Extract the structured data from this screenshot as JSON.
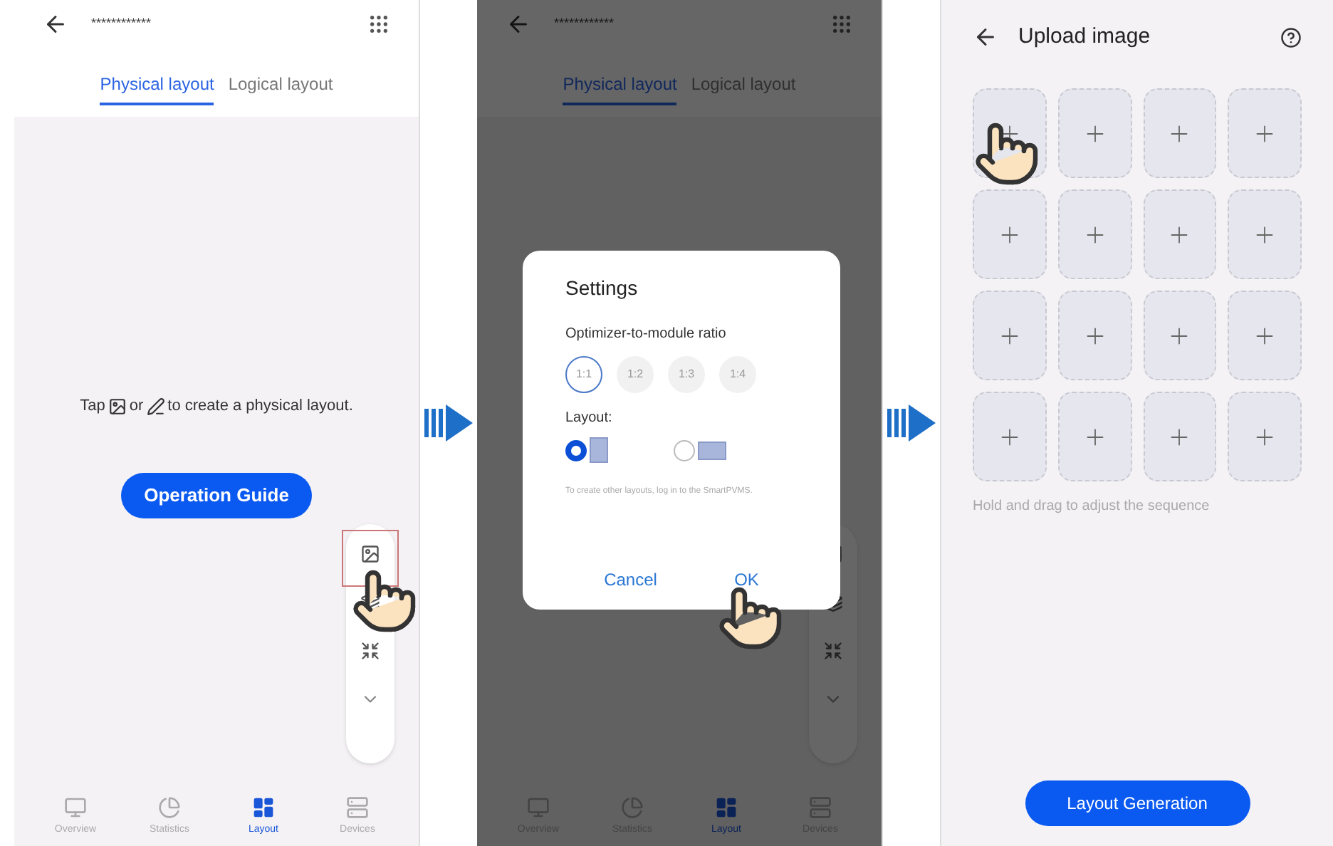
{
  "screens": [
    {
      "kind": "main",
      "title": "************",
      "tabs": [
        {
          "label": "Physical layout",
          "selected": true
        },
        {
          "label": "Logical layout",
          "selected": false
        }
      ],
      "hint": {
        "before": "Tap",
        "middle": "or",
        "after": "to create a physical layout."
      },
      "guide_button": "Operation Guide",
      "nav": [
        {
          "label": "Overview",
          "selected": false
        },
        {
          "label": "Statistics",
          "selected": false
        },
        {
          "label": "Layout",
          "selected": true
        },
        {
          "label": "Devices",
          "selected": false
        }
      ]
    },
    {
      "kind": "dialog",
      "title": "************",
      "tabs": [
        {
          "label": "Physical layout",
          "selected": true
        },
        {
          "label": "Logical layout",
          "selected": false
        }
      ],
      "nav": [
        {
          "label": "Overview",
          "selected": false
        },
        {
          "label": "Statistics",
          "selected": false
        },
        {
          "label": "Layout",
          "selected": true
        },
        {
          "label": "Devices",
          "selected": false
        }
      ],
      "dialog": {
        "title": "Settings",
        "ratio_label": "Optimizer-to-module ratio",
        "ratios": [
          {
            "label": "1:1",
            "selected": true
          },
          {
            "label": "1:2",
            "selected": false
          },
          {
            "label": "1:3",
            "selected": false
          },
          {
            "label": "1:4",
            "selected": false
          }
        ],
        "layout_label": "Layout:",
        "layouts": [
          {
            "kind": "portrait",
            "selected": true
          },
          {
            "kind": "landscape",
            "selected": false
          }
        ],
        "note": "To create other layouts, log in to the SmartPVMS.",
        "buttons": [
          "Cancel",
          "OK"
        ]
      }
    },
    {
      "kind": "upload",
      "title": "Upload image",
      "hint": "Hold and drag to adjust the sequence",
      "button": "Layout Generation"
    }
  ]
}
